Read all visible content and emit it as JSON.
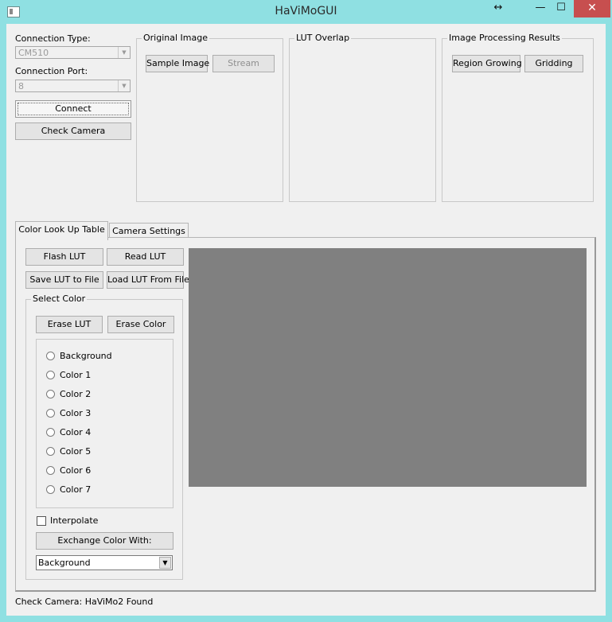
{
  "window": {
    "title": "HaViMoGUI",
    "controls": {
      "resize": "↔",
      "minimize": "—",
      "maximize": "☐",
      "close": "✕"
    }
  },
  "connection": {
    "type_label": "Connection Type:",
    "type_value": "CM510",
    "port_label": "Connection Port:",
    "port_value": "8",
    "connect_label": "Connect",
    "check_camera_label": "Check Camera"
  },
  "original_image": {
    "title": "Original Image",
    "sample_label": "Sample Image",
    "stream_label": "Stream"
  },
  "lut_overlap": {
    "title": "LUT Overlap"
  },
  "results": {
    "title": "Image Processing Results",
    "region_growing_label": "Region Growing",
    "gridding_label": "Gridding"
  },
  "tabs": [
    {
      "label": "Color Look Up Table",
      "active": true
    },
    {
      "label": "Camera Settings",
      "active": false
    }
  ],
  "lut_tab": {
    "flash_label": "Flash LUT",
    "read_label": "Read LUT",
    "save_label": "Save LUT to File",
    "load_label": "Load LUT From File",
    "select_color_title": "Select Color",
    "erase_lut_label": "Erase LUT",
    "erase_color_label": "Erase Color",
    "colors": [
      "Background",
      "Color 1",
      "Color 2",
      "Color 3",
      "Color 4",
      "Color 5",
      "Color 6",
      "Color 7"
    ],
    "interpolate_label": "Interpolate",
    "interpolate_checked": false,
    "exchange_label": "Exchange Color With:",
    "exchange_value": "Background"
  },
  "status": "Check Camera: HaViMo2 Found",
  "colors": {
    "frame": "#8fe0e2",
    "close_button": "#c74f4f",
    "lut_view": "#808080",
    "surface": "#f0f0f0"
  }
}
